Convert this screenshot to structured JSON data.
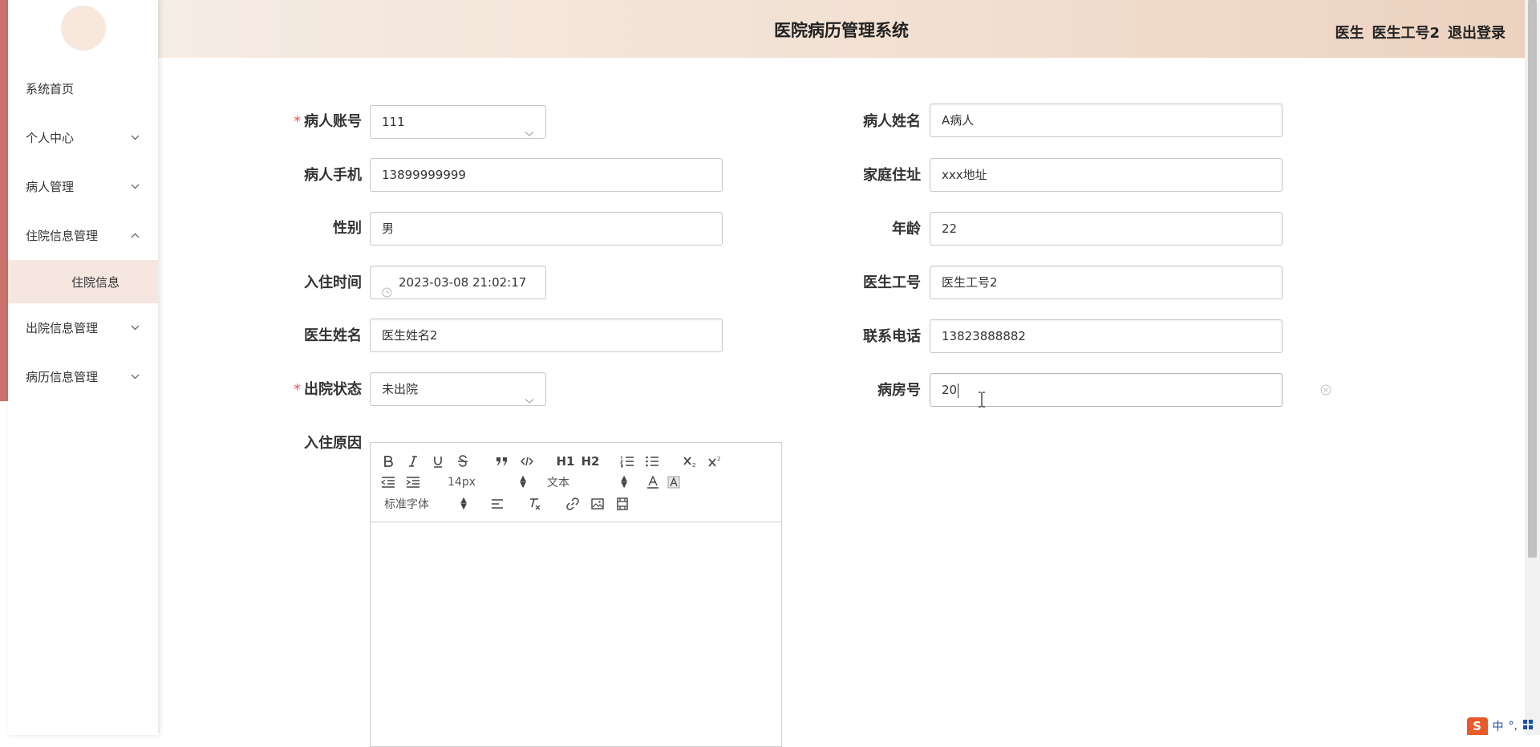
{
  "header": {
    "title": "医院病历管理系统",
    "role": "医生",
    "user": "医生工号2",
    "logout": "退出登录"
  },
  "sidebar": {
    "items": [
      {
        "label": "系统首页",
        "expandable": false
      },
      {
        "label": "个人中心",
        "expandable": true,
        "expanded": false
      },
      {
        "label": "病人管理",
        "expandable": true,
        "expanded": false
      },
      {
        "label": "住院信息管理",
        "expandable": true,
        "expanded": true,
        "children": [
          {
            "label": "住院信息",
            "active": true
          }
        ]
      },
      {
        "label": "出院信息管理",
        "expandable": true,
        "expanded": false
      },
      {
        "label": "病历信息管理",
        "expandable": true,
        "expanded": false
      }
    ]
  },
  "form": {
    "patient_account": {
      "label": "病人账号",
      "required": true,
      "value": "111"
    },
    "patient_name": {
      "label": "病人姓名",
      "value": "A病人"
    },
    "patient_phone": {
      "label": "病人手机",
      "value": "13899999999"
    },
    "home_address": {
      "label": "家庭住址",
      "value": "xxx地址"
    },
    "gender": {
      "label": "性别",
      "value": "男"
    },
    "age": {
      "label": "年龄",
      "value": "22"
    },
    "checkin_time": {
      "label": "入住时间",
      "value": "2023-03-08 21:02:17"
    },
    "doctor_id": {
      "label": "医生工号",
      "value": "医生工号2"
    },
    "doctor_name": {
      "label": "医生姓名",
      "value": "医生姓名2"
    },
    "contact_phone": {
      "label": "联系电话",
      "value": "13823888882"
    },
    "discharge_status": {
      "label": "出院状态",
      "required": true,
      "value": "未出院"
    },
    "ward_number": {
      "label": "病房号",
      "value": "20"
    },
    "admission_reason": {
      "label": "入住原因"
    }
  },
  "editor": {
    "font_size": "14px",
    "header_select": "文本",
    "font_family": "标准字体",
    "h1": "H1",
    "h2": "H2"
  },
  "ime": {
    "label": "中"
  }
}
